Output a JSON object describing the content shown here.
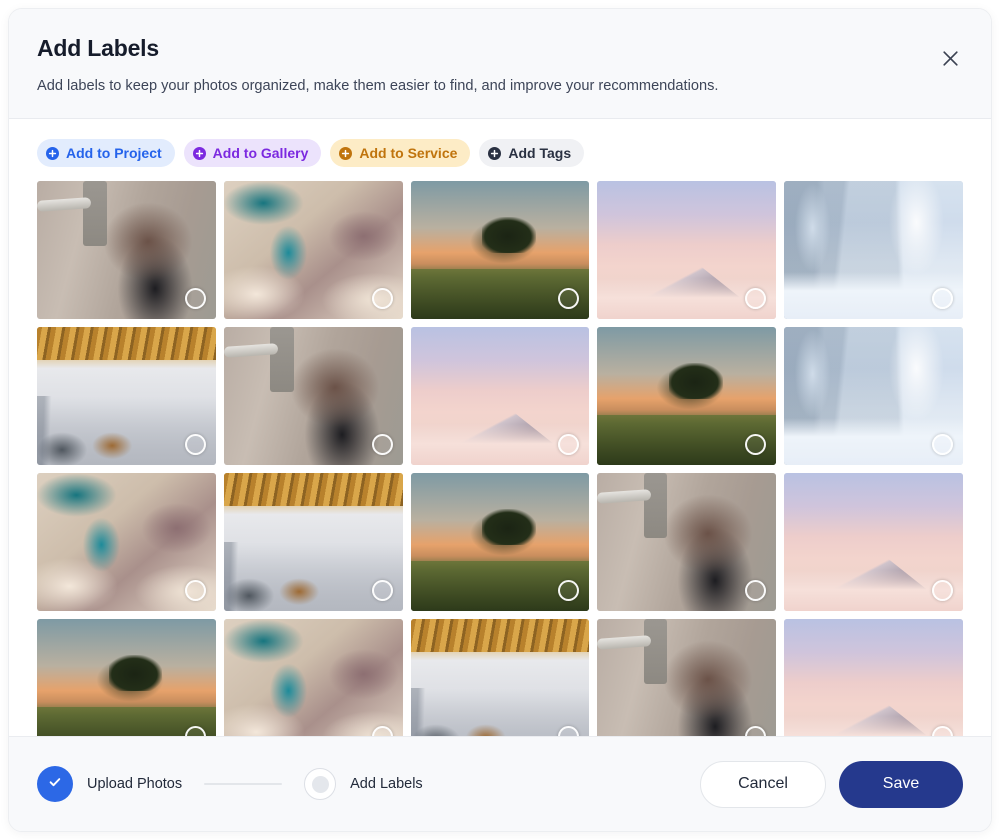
{
  "dialog": {
    "title": "Add Labels",
    "subtitle": "Add labels to keep your photos organized, make them easier to find, and improve your recommendations.",
    "close_icon": "close-icon"
  },
  "label_chips": [
    {
      "label": "Add to Project",
      "icon": "plus-circle-icon",
      "variant": "project",
      "text_color": "#2563eb",
      "bg_color": "#e2ecfd"
    },
    {
      "label": "Add to Gallery",
      "icon": "plus-circle-icon",
      "variant": "gallery",
      "text_color": "#7c29e0",
      "bg_color": "#ece3fc"
    },
    {
      "label": "Add to Service",
      "icon": "plus-circle-icon",
      "variant": "service",
      "text_color": "#c0740d",
      "bg_color": "#fdecc6"
    },
    {
      "label": "Add Tags",
      "icon": "plus-circle-icon",
      "variant": "tags",
      "text_color": "#2a3142",
      "bg_color": "#f0f1f4"
    }
  ],
  "photo_grid": {
    "columns": 5,
    "tiles": [
      {
        "art": "portrait",
        "alt": "Woman leaning on railing by concrete building",
        "selected": false
      },
      {
        "art": "aerial",
        "alt": "Aerial view of turquoise river delta",
        "selected": false
      },
      {
        "art": "tree",
        "alt": "Lone tree on hilltop at sunset",
        "selected": false
      },
      {
        "art": "peak",
        "alt": "Snowy mountain peak above pink clouds",
        "selected": false
      },
      {
        "art": "snow",
        "alt": "Snow covered forest path in winter",
        "selected": false
      },
      {
        "art": "office",
        "alt": "Open plan office with wooden ceiling",
        "selected": false
      },
      {
        "art": "portrait",
        "alt": "Woman leaning on railing by concrete building",
        "selected": false
      },
      {
        "art": "peak",
        "alt": "Snowy mountain peak above pink clouds",
        "selected": false
      },
      {
        "art": "tree",
        "alt": "Lone tree on hilltop at sunset",
        "selected": false
      },
      {
        "art": "snow",
        "alt": "Snow covered forest path in winter",
        "selected": false
      },
      {
        "art": "aerial",
        "alt": "Aerial view of turquoise river delta",
        "selected": false
      },
      {
        "art": "office",
        "alt": "Open plan office with wooden ceiling",
        "selected": false
      },
      {
        "art": "tree",
        "alt": "Lone tree on hilltop at sunset",
        "selected": false
      },
      {
        "art": "portrait",
        "alt": "Woman leaning on railing by concrete building",
        "selected": false
      },
      {
        "art": "peak",
        "alt": "Snowy mountain peak above pink clouds",
        "selected": false
      },
      {
        "art": "tree",
        "alt": "Lone tree on hilltop at sunset",
        "selected": false
      },
      {
        "art": "aerial",
        "alt": "Aerial view of turquoise river delta",
        "selected": false
      },
      {
        "art": "office",
        "alt": "Open plan office with wooden ceiling",
        "selected": false
      },
      {
        "art": "portrait",
        "alt": "Woman leaning on railing by concrete building",
        "selected": false
      },
      {
        "art": "peak",
        "alt": "Snowy mountain peak above pink clouds",
        "selected": false
      }
    ]
  },
  "footer": {
    "steps": [
      {
        "label": "Upload Photos",
        "state": "completed",
        "icon": "check-icon"
      },
      {
        "label": "Add Labels",
        "state": "current",
        "icon": "dot-icon"
      }
    ],
    "cancel_label": "Cancel",
    "save_label": "Save",
    "save_bg_color": "#25398d",
    "step_done_color": "#2c68e6"
  }
}
